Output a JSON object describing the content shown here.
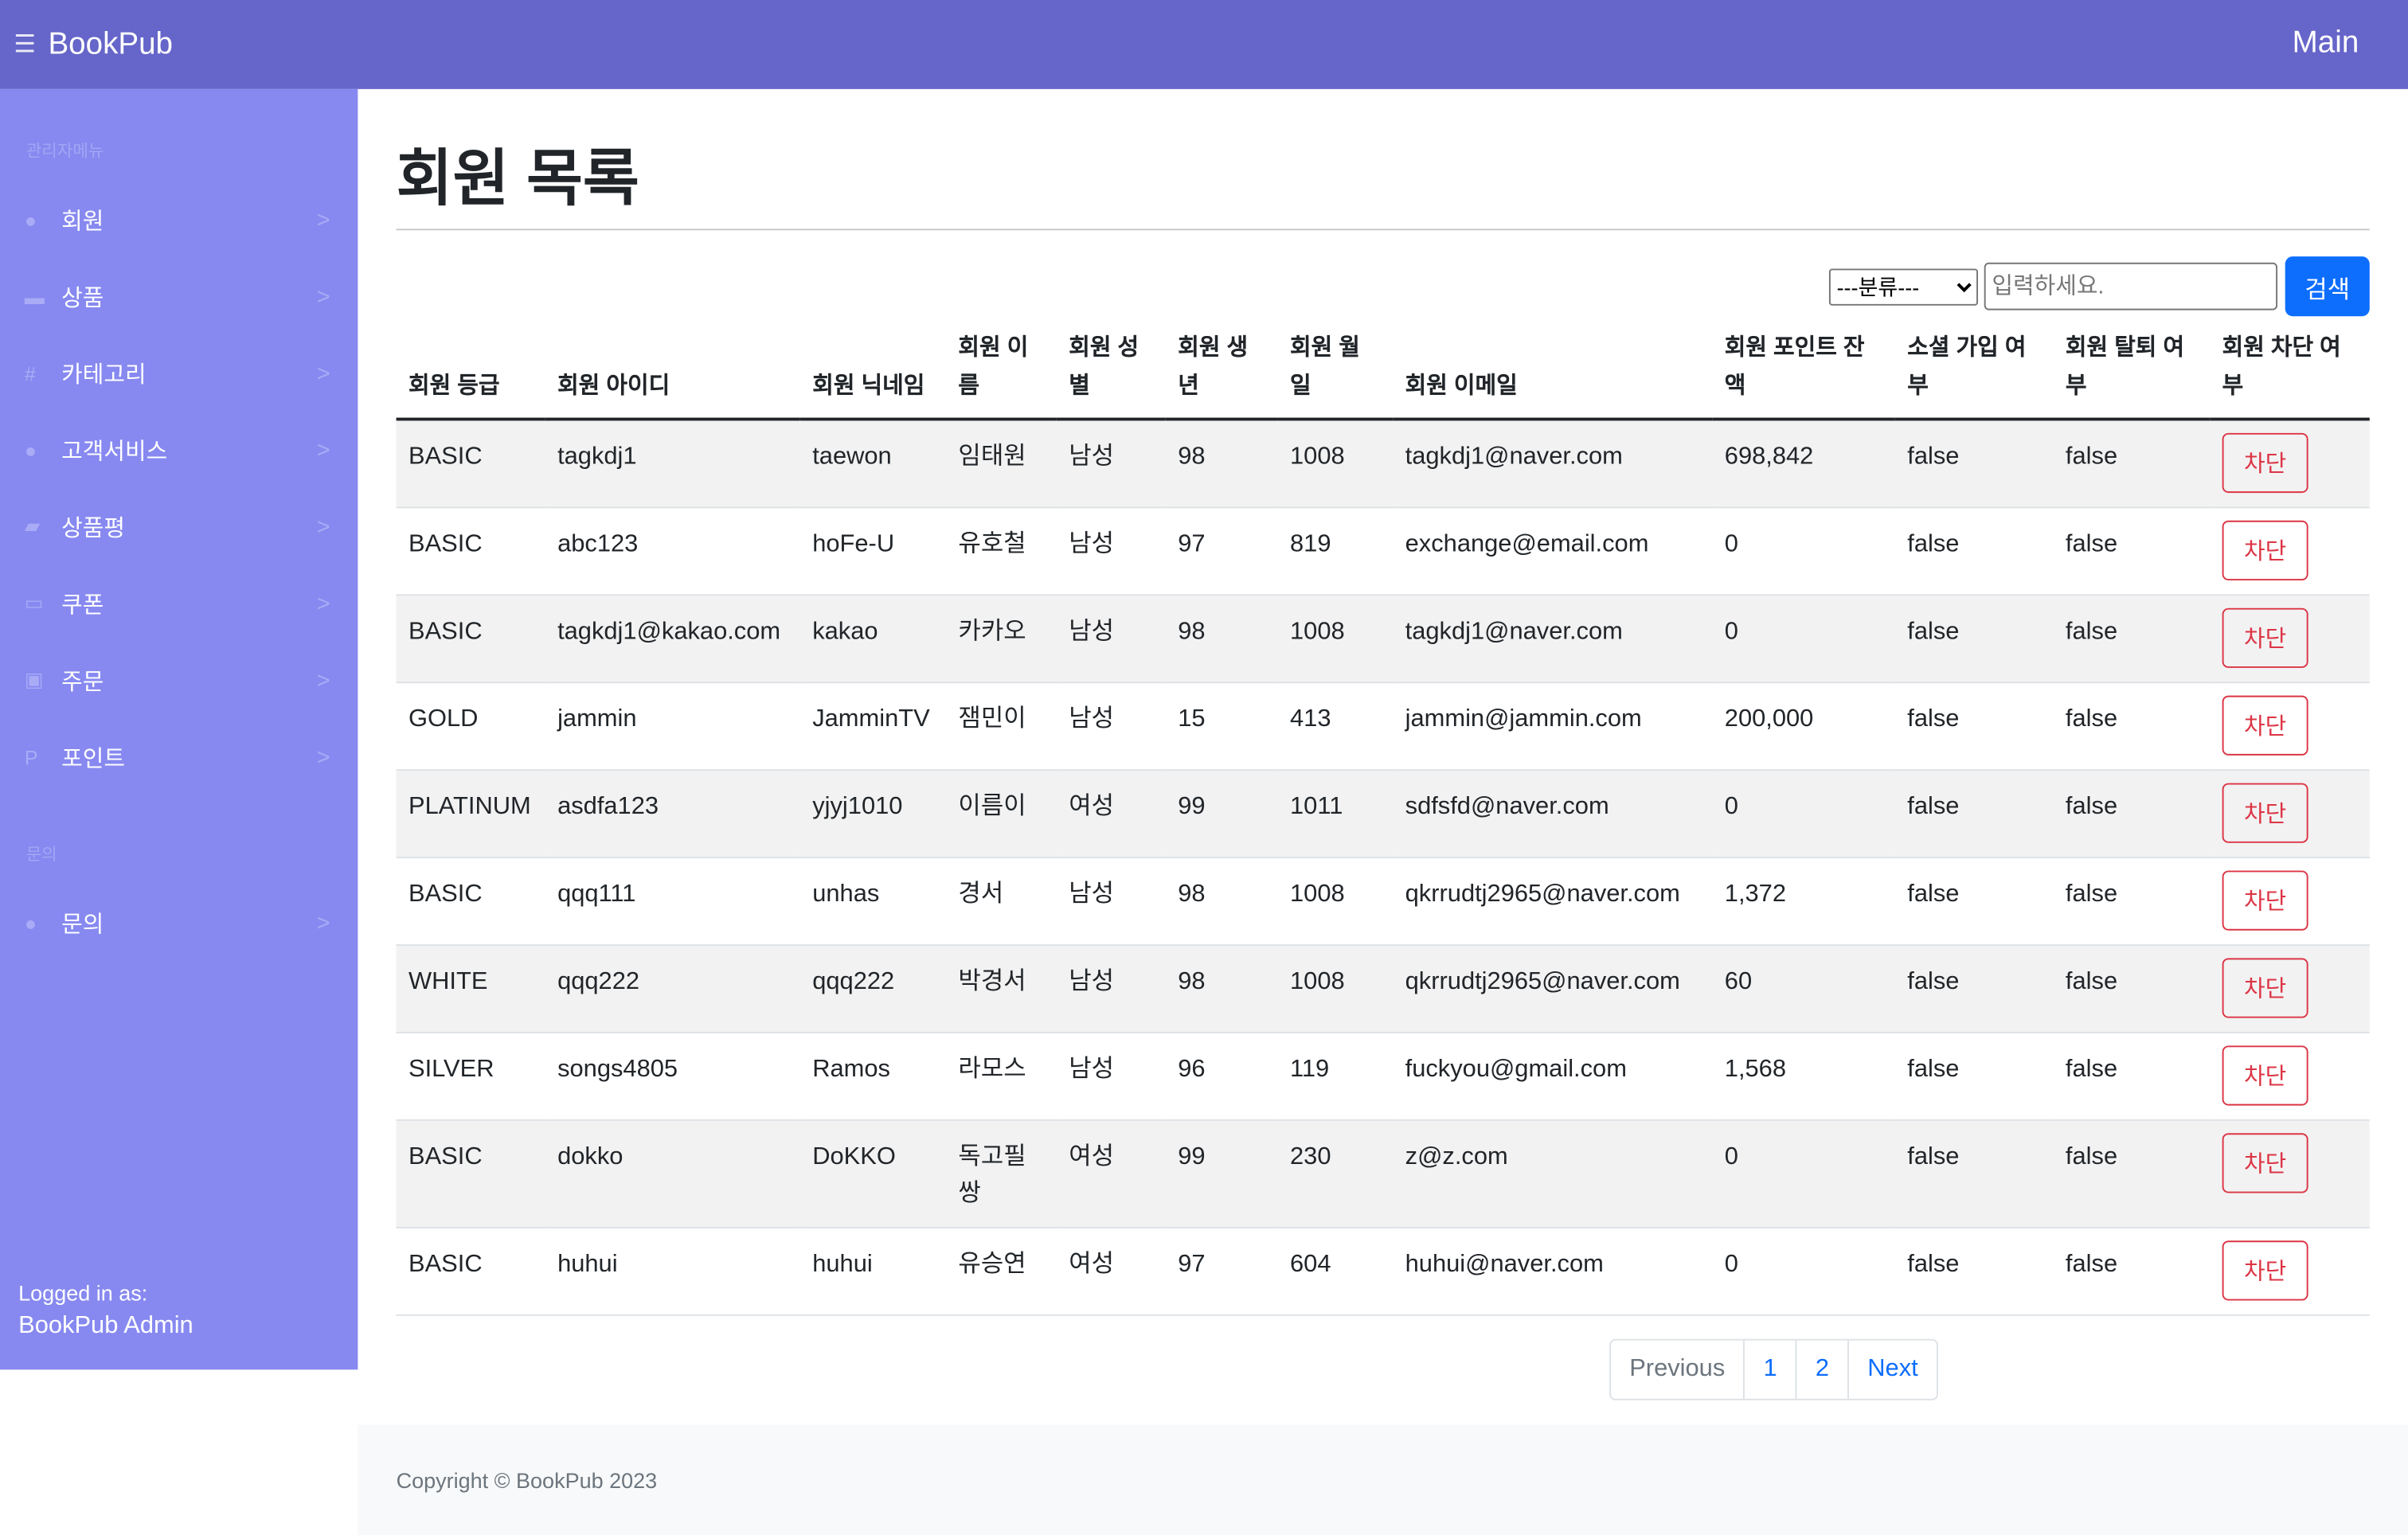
{
  "header": {
    "brand": "BookPub",
    "main_link": "Main"
  },
  "sidebar": {
    "section1": "관리자메뉴",
    "section2": "문의",
    "items": [
      {
        "label": "회원",
        "icon": "user-circle-icon"
      },
      {
        "label": "상품",
        "icon": "book-icon"
      },
      {
        "label": "카테고리",
        "icon": "hash-icon"
      },
      {
        "label": "고객서비스",
        "icon": "alert-circle-icon"
      },
      {
        "label": "상품평",
        "icon": "file-pen-icon"
      },
      {
        "label": "쿠폰",
        "icon": "credit-card-icon"
      },
      {
        "label": "주문",
        "icon": "clipboard-icon"
      },
      {
        "label": "포인트",
        "icon": "p-icon"
      }
    ],
    "inquiry": {
      "label": "문의",
      "icon": "question-circle-icon"
    },
    "logged_label": "Logged in as:",
    "logged_user": "BookPub Admin"
  },
  "page": {
    "title": "회원 목록"
  },
  "search": {
    "select_value": "---분류---",
    "placeholder": "입력하세요.",
    "button": "검색"
  },
  "table": {
    "headers": [
      "회원 등급",
      "회원 아이디",
      "회원 닉네임",
      "회원 이름",
      "회원 성별",
      "회원 생년",
      "회원 월일",
      "회원 이메일",
      "회원 포인트 잔액",
      "소셜 가입 여부",
      "회원 탈퇴 여부",
      "회원 차단 여부"
    ],
    "block_label": "차단",
    "rows": [
      [
        "BASIC",
        "tagkdj1",
        "taewon",
        "임태원",
        "남성",
        "98",
        "1008",
        "tagkdj1@naver.com",
        "698,842",
        "false",
        "false"
      ],
      [
        "BASIC",
        "abc123",
        "hoFe-U",
        "유호철",
        "남성",
        "97",
        "819",
        "exchange@email.com",
        "0",
        "false",
        "false"
      ],
      [
        "BASIC",
        "tagkdj1@kakao.com",
        "kakao",
        "카카오",
        "남성",
        "98",
        "1008",
        "tagkdj1@naver.com",
        "0",
        "false",
        "false"
      ],
      [
        "GOLD",
        "jammin",
        "JamminTV",
        "잼민이",
        "남성",
        "15",
        "413",
        "jammin@jammin.com",
        "200,000",
        "false",
        "false"
      ],
      [
        "PLATINUM",
        "asdfa123",
        "yjyj1010",
        "이름이",
        "여성",
        "99",
        "1011",
        "sdfsfd@naver.com",
        "0",
        "false",
        "false"
      ],
      [
        "BASIC",
        "qqq111",
        "unhas",
        "경서",
        "남성",
        "98",
        "1008",
        "qkrrudtj2965@naver.com",
        "1,372",
        "false",
        "false"
      ],
      [
        "WHITE",
        "qqq222",
        "qqq222",
        "박경서",
        "남성",
        "98",
        "1008",
        "qkrrudtj2965@naver.com",
        "60",
        "false",
        "false"
      ],
      [
        "SILVER",
        "songs4805",
        "Ramos",
        "라모스",
        "남성",
        "96",
        "119",
        "fuckyou@gmail.com",
        "1,568",
        "false",
        "false"
      ],
      [
        "BASIC",
        "dokko",
        "DoKKO",
        "독고필쌍",
        "여성",
        "99",
        "230",
        "z@z.com",
        "0",
        "false",
        "false"
      ],
      [
        "BASIC",
        "huhui",
        "huhui",
        "유승연",
        "여성",
        "97",
        "604",
        "huhui@naver.com",
        "0",
        "false",
        "false"
      ]
    ]
  },
  "pagination": {
    "previous": "Previous",
    "pages": [
      "1",
      "2"
    ],
    "next": "Next"
  },
  "footer": {
    "text": "Copyright © BookPub 2023"
  }
}
